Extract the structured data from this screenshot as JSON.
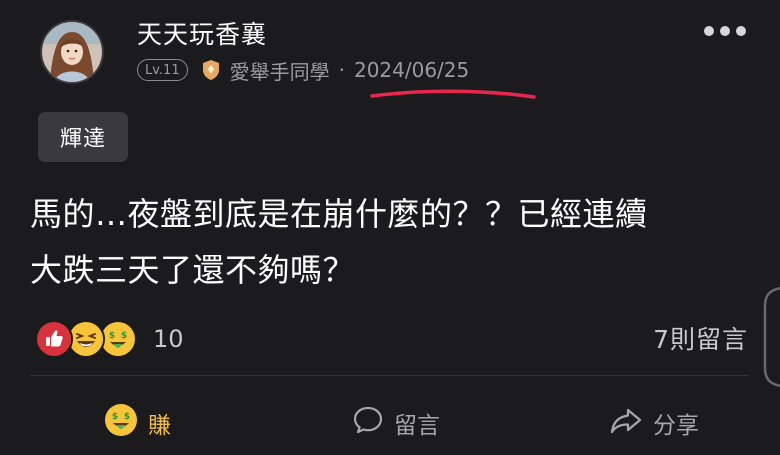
{
  "post": {
    "author": "天天玩香襄",
    "level": "Lv.11",
    "board": "愛舉手同學",
    "separator": "·",
    "date": "2024/06/25",
    "tag": "輝達",
    "body_line1": "馬的…夜盤到底是在崩什麼的？？已經連續",
    "body_line2": "大跌三天了還不夠嗎？",
    "reaction_count": "10",
    "comment_count": "7則留言"
  },
  "reactions": [
    "thumbs-up-icon",
    "laughing-icon",
    "money-mouth-icon"
  ],
  "actions": {
    "earn": "賺",
    "comment": "留言",
    "share": "分享"
  },
  "colors": {
    "background": "#1b1b1d",
    "annotation": "#e8264f",
    "earn_accent": "#f2bd3b"
  }
}
